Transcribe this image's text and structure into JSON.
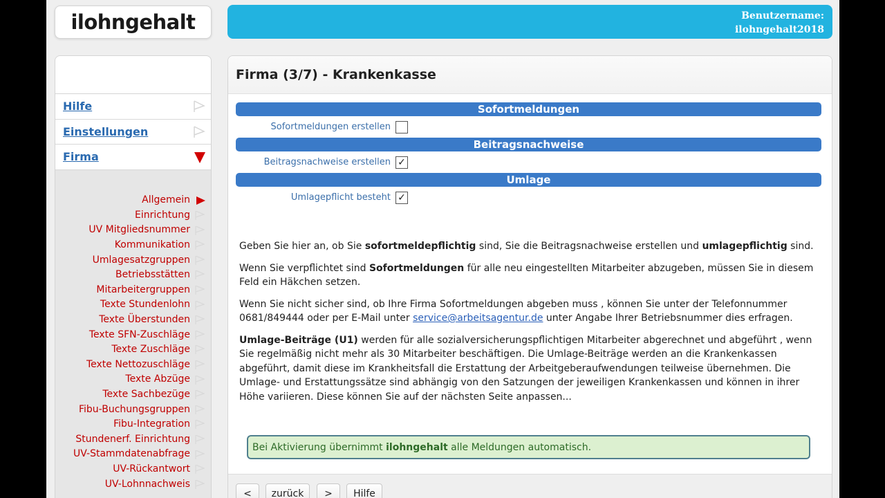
{
  "brand": {
    "logo_text": "ilohngehalt"
  },
  "header": {
    "username_label": "Benutzername:",
    "username": "ilohngehalt2018"
  },
  "sidebar": {
    "items": [
      {
        "label": "Hilfe",
        "icon": "flag-icon"
      },
      {
        "label": "Einstellungen",
        "icon": "flag-icon"
      },
      {
        "label": "Firma",
        "icon": "expanded-triangle-icon"
      }
    ],
    "sub_items": [
      {
        "label": "Allgemein",
        "active": true
      },
      {
        "label": "Einrichtung"
      },
      {
        "label": "UV Mitgliedsnummer"
      },
      {
        "label": "Kommunikation"
      },
      {
        "label": "Umlagesatzgruppen"
      },
      {
        "label": "Betriebsstätten"
      },
      {
        "label": "Mitarbeitergruppen"
      },
      {
        "label": "Texte Stundenlohn"
      },
      {
        "label": "Texte Überstunden"
      },
      {
        "label": "Texte SFN-Zuschläge"
      },
      {
        "label": "Texte Zuschläge"
      },
      {
        "label": "Texte Nettozuschläge"
      },
      {
        "label": "Texte Abzüge"
      },
      {
        "label": "Texte Sachbezüge"
      },
      {
        "label": "Fibu-Buchungsgruppen"
      },
      {
        "label": "Fibu-Integration"
      },
      {
        "label": "Stundenerf. Einrichtung"
      },
      {
        "label": "UV-Stammdatenabfrage"
      },
      {
        "label": "UV-Rückantwort"
      },
      {
        "label": "UV-Lohnnachweis"
      }
    ]
  },
  "main": {
    "title": "Firma (3/7) - Krankenkasse",
    "sections": [
      {
        "heading": "Sofortmeldungen",
        "field_label": "Sofortmeldungen erstellen",
        "checked": false
      },
      {
        "heading": "Beitragsnachweise",
        "field_label": "Beitragsnachweise erstellen",
        "checked": true
      },
      {
        "heading": "Umlage",
        "field_label": "Umlagepflicht besteht",
        "checked": true
      }
    ],
    "text": {
      "p1_a": "Geben Sie hier an, ob Sie ",
      "p1_b": "sofortmeldepflichtig",
      "p1_c": " sind, Sie die Beitragsnachweise erstellen und ",
      "p1_d": "umlagepflichtig",
      "p1_e": " sind.",
      "p2_a": "Wenn Sie verpflichtet sind ",
      "p2_b": "Sofortmeldungen",
      "p2_c": " für alle neu eingestellten Mitarbeiter abzugeben, müssen Sie in diesem Feld ein Häkchen setzen.",
      "p3_a": "Wenn Sie nicht sicher sind, ob Ihre Firma Sofortmeldungen abgeben muss , können Sie unter der Telefonnummer 0681/849444 oder per E-Mail unter ",
      "p3_link": "service@arbeitsagentur.de",
      "p3_c": " unter Angabe Ihrer Betriebsnummer dies erfragen.",
      "p4_a": "Umlage-Beiträge (U1)",
      "p4_b": " werden für alle sozialversicherungspflichtigen Mitarbeiter abgerechnet und abgeführt , wenn Sie regelmäßig nicht mehr als 30 Mitarbeiter beschäftigen. Die Umlage-Beiträge werden an die Krankenkassen abgeführt, damit diese im Krankheitsfall die Erstattung der Arbeitgeberaufwendungen teilweise übernehmen. Die Umlage- und Erstattungssätze sind abhängig von den Satzungen der jeweiligen Krankenkassen und können in ihrer Höhe variieren. Diese können Sie auf der nächsten Seite anpassen..."
    },
    "notice": {
      "a": "Bei Aktivierung übernimmt ",
      "b": "ilohngehalt",
      "c": " alle Meldungen automatisch."
    }
  },
  "footer": {
    "buttons": [
      "<",
      "zurück",
      ">",
      "Hilfe"
    ]
  }
}
